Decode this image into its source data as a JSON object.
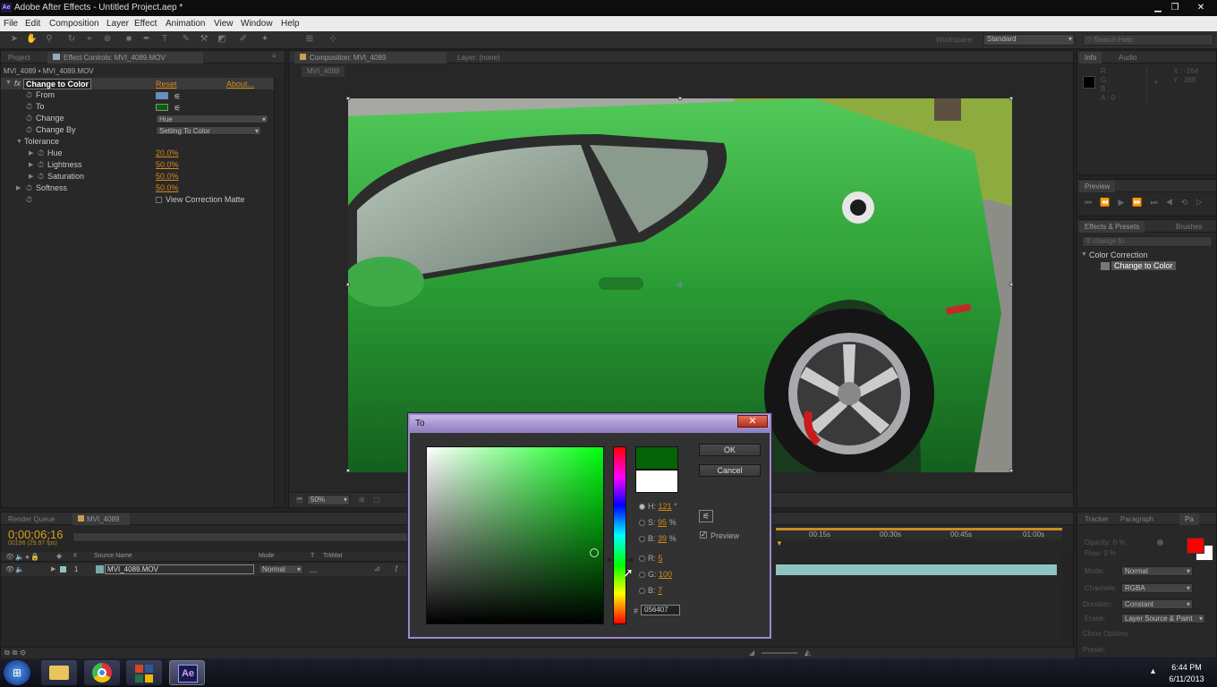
{
  "window": {
    "title": "Adobe After Effects - Untitled Project.aep *",
    "app_icon": "Ae",
    "minimize": "▁",
    "restore": "❐",
    "close": "✕"
  },
  "menu": [
    "File",
    "Edit",
    "Composition",
    "Layer",
    "Effect",
    "Animation",
    "View",
    "Window",
    "Help"
  ],
  "toolbar": {
    "workspace_label": "Workspace:",
    "workspace_value": "Standard",
    "search_placeholder": "Search Help"
  },
  "effect_panel": {
    "tabs": [
      "Project",
      "Effect Controls: MVI_4089.MOV"
    ],
    "breadcrumb": "MVI_4089 • MVI_4089.MOV",
    "effect_name": "Change to Color",
    "fx_badge": "fx",
    "reset": "Reset",
    "about": "About...",
    "from_label": "From",
    "to_label": "To",
    "from_color": "#5b8fd6",
    "to_color": "#056407",
    "change_label": "Change",
    "change_value": "Hue",
    "change_by_label": "Change By",
    "change_by_value": "Setting To Color",
    "tolerance_label": "Tolerance",
    "hue_label": "Hue",
    "hue_value": "20.0%",
    "lightness_label": "Lightness",
    "lightness_value": "50.0%",
    "saturation_label": "Saturation",
    "saturation_value": "50.0%",
    "softness_label": "Softness",
    "softness_value": "50.0%",
    "matte_label": "View Correction Matte"
  },
  "comp_panel": {
    "tabs": [
      "Composition: MVI_4089",
      "Layer: (none)"
    ],
    "subtab": "MVI_4089",
    "zoom": "50%"
  },
  "info_panel": {
    "tabs": [
      "Info",
      "Audio"
    ],
    "r": "R :",
    "g": "G :",
    "b": "B :",
    "a": "A : 0",
    "x": "X : -164",
    "y": "Y : 388"
  },
  "preview_panel": {
    "tab": "Preview"
  },
  "effects_presets": {
    "tabs": [
      "Effects & Presets",
      "Brushes"
    ],
    "search_value": "change to",
    "category": "Color Correction",
    "item": "Change to Color"
  },
  "paint_panel": {
    "tabs": [
      "Tracker",
      "Paragraph",
      "Pa"
    ],
    "opacity": "Opacity: 0 %",
    "flow": "Flow: 0 %",
    "mode": "Mode:",
    "mode_value": "Normal",
    "channels": "Channels:",
    "channels_value": "RGBA",
    "duration": "Duration:",
    "duration_value": "Constant",
    "erase": "Erase:",
    "erase_value": "Layer Source & Paint",
    "clone": "Clone Options",
    "preset": "Preset:",
    "fg_color": "#ff0000",
    "bg_color": "#ffffff"
  },
  "timeline": {
    "tabs": [
      "Render Queue",
      "MVI_4089"
    ],
    "timecode": "0;00;06;16",
    "frames": "00196 (29.97 fps)",
    "col_source": "Source Name",
    "col_mode": "Mode",
    "col_t": "T",
    "col_trkmat": "TrkMat",
    "layer_index": "1",
    "layer_name": "MVI_4089.MOV",
    "layer_mode": "Normal",
    "ruler": [
      "00:15s",
      "00:30s",
      "00:45s",
      "01:00s"
    ]
  },
  "dialog": {
    "title": "To",
    "ok": "OK",
    "cancel": "Cancel",
    "preview": "Preview",
    "h_label": "H:",
    "h_value": "121",
    "h_unit": "°",
    "s_label": "S:",
    "s_value": "95",
    "s_unit": "%",
    "b_label": "B:",
    "b_value": "39",
    "b_unit": "%",
    "r_label": "R:",
    "r_value": "5",
    "g_label": "G:",
    "g_value": "100",
    "bb_label": "B:",
    "bb_value": "7",
    "hex_label": "#",
    "hex_value": "056407",
    "new_color": "#056407",
    "old_color": "#ffffff"
  },
  "taskbar": {
    "time": "6:44 PM",
    "date": "6/11/2013",
    "ae_label": "Ae"
  }
}
